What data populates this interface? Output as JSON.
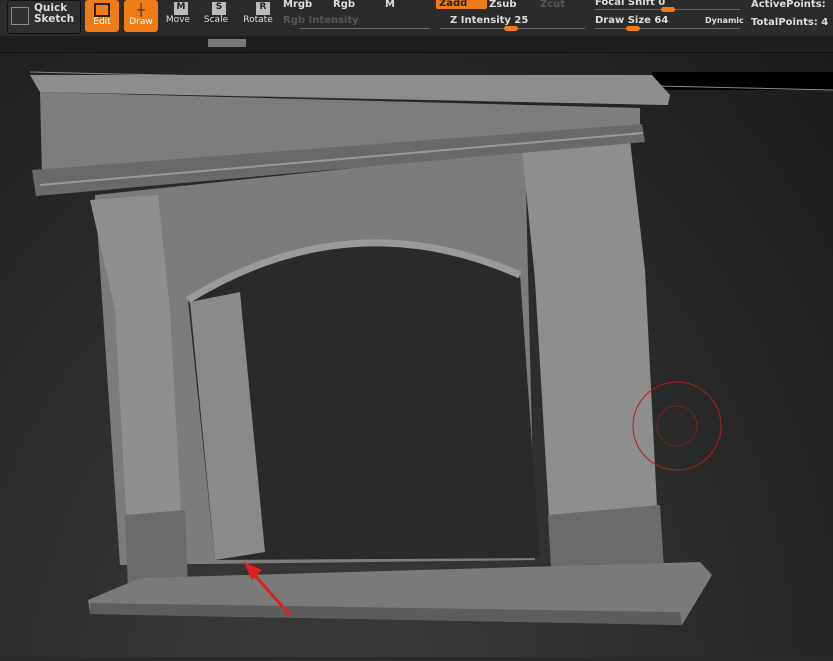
{
  "toolbar": {
    "quick_sketch": "Quick Sketch",
    "edit": "Edit",
    "draw": "Draw",
    "move": "Move",
    "scale": "Scale",
    "rotate": "Rotate",
    "move_key": "M",
    "scale_key": "S",
    "rotate_key": "R",
    "mrgb": "Mrgb",
    "rgb": "Rgb",
    "m": "M",
    "rgb_intensity": "Rgb Intensity",
    "zadd": "Zadd",
    "zsub": "Zsub",
    "zcut": "Zcut",
    "z_intensity": "Z Intensity 25",
    "focal_shift": "Focal Shift 0",
    "draw_size": "Draw Size 64",
    "dynamic": "Dynamic",
    "active_points": "ActivePoints:",
    "total_points": "TotalPoints: 4"
  },
  "sliders": {
    "z_intensity": 25,
    "focal_shift": 0,
    "draw_size": 64
  },
  "colors": {
    "accent": "#f07c18",
    "brush": "#b02020",
    "arrow": "#e02020"
  }
}
